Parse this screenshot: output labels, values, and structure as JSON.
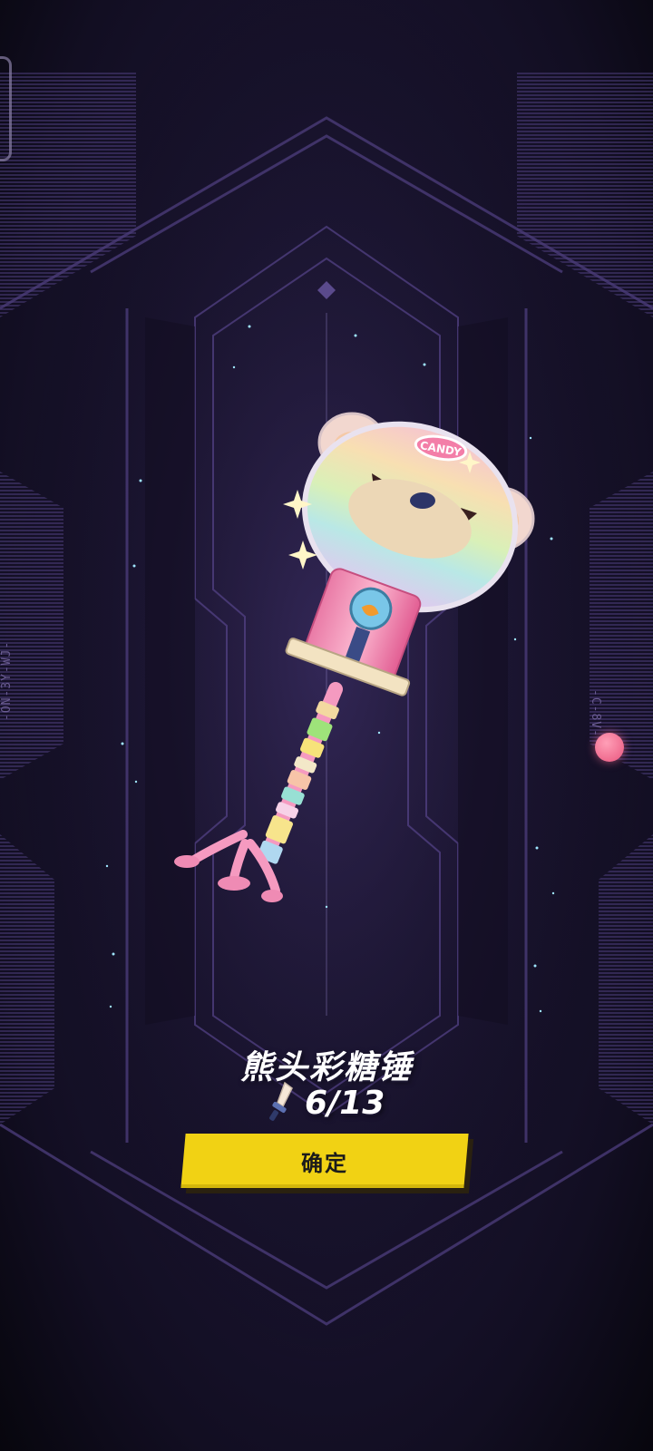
{
  "reward": {
    "item_name": "熊头彩糖锤",
    "count": "6/13",
    "candy_tag": "CANDY",
    "currency_icon": "sword-icon"
  },
  "confirm": {
    "label": "确定"
  },
  "side_codes": {
    "left": "-ON-3Y-WJ-",
    "right": "-C-8V-"
  },
  "colors": {
    "background": "#1b1532",
    "panel_line": "#5b4a8c",
    "button": "#f1d214",
    "button_text": "#1b1b1b",
    "accent_pink": "#e9567e"
  }
}
